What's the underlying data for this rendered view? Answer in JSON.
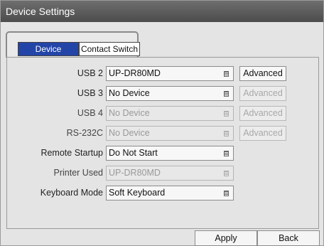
{
  "window": {
    "title": "Device Settings"
  },
  "tabs": [
    {
      "label": "Device",
      "active": true
    },
    {
      "label": "Contact Switch",
      "active": false
    }
  ],
  "rows": [
    {
      "label": "USB 2",
      "value": "UP-DR80MD",
      "enabled": true,
      "advanced": "Advanced",
      "advanced_enabled": true
    },
    {
      "label": "USB 3",
      "value": "No Device",
      "enabled": true,
      "advanced": "Advanced",
      "advanced_enabled": false
    },
    {
      "label": "USB 4",
      "value": "No Device",
      "enabled": false,
      "advanced": "Advanced",
      "advanced_enabled": false
    },
    {
      "label": "RS-232C",
      "value": "No Device",
      "enabled": false,
      "advanced": "Advanced",
      "advanced_enabled": false
    },
    {
      "label": "Remote Startup",
      "value": "Do Not Start",
      "enabled": true
    },
    {
      "label": "Printer Used",
      "value": "UP-DR80MD",
      "enabled": false
    },
    {
      "label": "Keyboard Mode",
      "value": "Soft Keyboard",
      "enabled": true
    }
  ],
  "buttons": {
    "apply": "Apply",
    "back": "Back"
  },
  "colors": {
    "title_bar": "#555555",
    "active_tab": "#2345a8",
    "panel": "#e4e4e4"
  }
}
